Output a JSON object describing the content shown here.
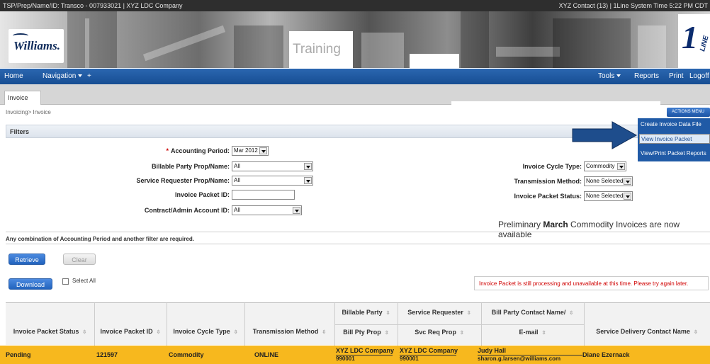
{
  "topbar": {
    "left": "TSP/Prep/Name/ID: Transco - 007933021  |  XYZ LDC Company",
    "right": "XYZ Contact (13)  |  1Line System Time  5:22 PM CDT"
  },
  "banner": {
    "logo_left": "Williams.",
    "training": "Training",
    "logo_right_num": "1",
    "logo_right_text": "LINE"
  },
  "nav": {
    "home": "Home",
    "navigation": "Navigation",
    "plus": "+",
    "tools": "Tools",
    "reports": "Reports",
    "print": "Print",
    "logoff": "Logoff"
  },
  "tab": {
    "label": "Invoice"
  },
  "breadcrumb": "Invoicing> Invoice",
  "actions": {
    "label": "ACTIONS MENU",
    "items": [
      "Create Invoice Data File",
      "View Invoice Packet",
      "View/Print Packet Reports"
    ]
  },
  "filters": {
    "title": "Filters",
    "required_mark": "*",
    "accounting_period_label": "Accounting Period:",
    "accounting_period_value": "Mar 2012",
    "billable_party_label": "Billable Party Prop/Name:",
    "billable_party_value": "All",
    "service_requester_label": "Service Requester Prop/Name:",
    "service_requester_value": "All",
    "invoice_packet_id_label": "Invoice Packet ID:",
    "invoice_packet_id_value": "",
    "contract_label": "Contract/Admin Account ID:",
    "contract_value": "All",
    "cycle_type_label": "Invoice Cycle Type:",
    "cycle_type_value": "Commodity",
    "transmission_label": "Transmission Method:",
    "transmission_value": "None Selected",
    "packet_status_label": "Invoice Packet Status:",
    "packet_status_value": "None Selected"
  },
  "notice": {
    "pre": "Preliminary ",
    "bold": "March",
    "post": " Commodity Invoices are now available"
  },
  "combo_note": "Any combination of Accounting Period and another filter are required.",
  "buttons": {
    "retrieve": "Retrieve",
    "clear": "Clear",
    "download": "Download",
    "select_all": "Select All"
  },
  "warning": "Invoice Packet is still processing and unavailable at this time. Please try again later.",
  "table": {
    "headers": {
      "status": "Invoice Packet Status",
      "packet_id": "Invoice Packet ID",
      "cycle_type": "Invoice Cycle Type",
      "transmission": "Transmission Method",
      "billable_top": "Billable Party",
      "billable_bottom": "Bill Pty Prop",
      "requester_top": "Service Requester",
      "requester_bottom": "Svc Req Prop",
      "contact_top": "Bill Party Contact Name/",
      "contact_bottom": "E-mail",
      "delivery": "Service Delivery Contact Name"
    },
    "row": {
      "status": "Pending",
      "packet_id": "121597",
      "cycle_type": "Commodity",
      "transmission": "ONLINE",
      "billable_name": "XYZ LDC Company",
      "billable_prop": "990001",
      "requester_name": "XYZ LDC Company",
      "requester_prop": "990001",
      "contact_name": "Judy Hall",
      "contact_email": "sharon.g.larsen@williams.com",
      "delivery_contact": "Diane Ezernack"
    }
  },
  "colors": {
    "nav": "#1d59a3",
    "row_highlight": "#f7b81e",
    "warning_text": "#d00000",
    "arrow": "#1e4d8c"
  }
}
